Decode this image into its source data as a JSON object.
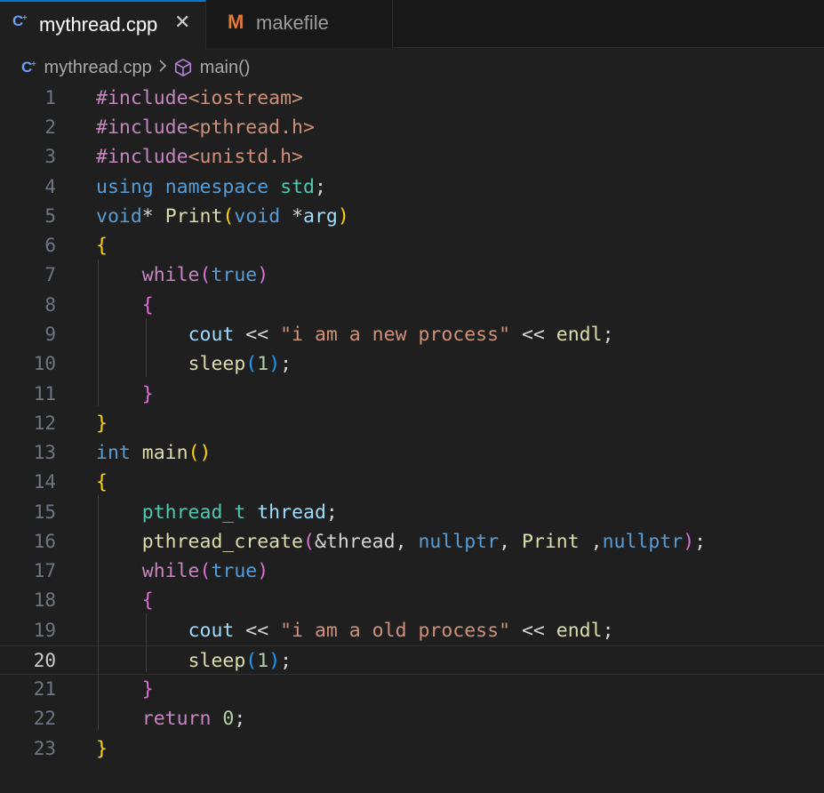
{
  "tabs": [
    {
      "label": "mythread.cpp",
      "icon": "cpp-file-icon",
      "active": true
    },
    {
      "label": "makefile",
      "icon": "makefile-icon",
      "active": false
    }
  ],
  "breadcrumb": {
    "file": "mythread.cpp",
    "symbol": "main()"
  },
  "editor": {
    "current_line": 20,
    "line_numbers": [
      "1",
      "2",
      "3",
      "4",
      "5",
      "6",
      "7",
      "8",
      "9",
      "10",
      "11",
      "12",
      "13",
      "14",
      "15",
      "16",
      "17",
      "18",
      "19",
      "20",
      "21",
      "22",
      "23"
    ],
    "tokens": {
      "l1": [
        "#include",
        "<iostream>"
      ],
      "l2": [
        "#include",
        "<pthread.h>"
      ],
      "l3": [
        "#include",
        "<unistd.h>"
      ],
      "l4": [
        "using",
        " ",
        "namespace",
        " ",
        "std",
        ";"
      ],
      "l5": [
        "void",
        "*",
        " ",
        "Print",
        "(",
        "void",
        " *",
        "arg",
        ")"
      ],
      "l6": [
        "{"
      ],
      "l7": [
        "while",
        "(",
        "true",
        ")"
      ],
      "l8": [
        "{"
      ],
      "l9": [
        "cout",
        " << ",
        "\"i am a new process\"",
        " << ",
        "endl",
        ";"
      ],
      "l10": [
        "sleep",
        "(",
        "1",
        ")",
        ";"
      ],
      "l11": [
        "}"
      ],
      "l12": [
        "}"
      ],
      "l13": [
        "int",
        " ",
        "main",
        "()"
      ],
      "l14": [
        "{"
      ],
      "l15": [
        "pthread_t",
        " ",
        "thread",
        ";"
      ],
      "l16": [
        "pthread_create",
        "(",
        "&thread",
        ", ",
        "nullptr",
        ", ",
        "Print",
        " ,",
        "nullptr",
        ")",
        ";"
      ],
      "l17": [
        "while",
        "(",
        "true",
        ")"
      ],
      "l18": [
        "{"
      ],
      "l19": [
        "cout",
        " << ",
        "\"i am a old process\"",
        " << ",
        "endl",
        ";"
      ],
      "l20": [
        "sleep",
        "(",
        "1",
        ")",
        ";"
      ],
      "l21": [
        "}"
      ],
      "l22": [
        "return",
        " ",
        "0",
        ";"
      ],
      "l23": [
        "}"
      ]
    }
  },
  "colors": {
    "background": "#1f1f1f",
    "tab_active_border": "#0078d4",
    "preprocessor": "#c586c0",
    "include_path": "#ce9178",
    "keyword": "#569cd6",
    "type": "#4ec9b0",
    "function": "#dcdcaa",
    "variable": "#9cdcfe",
    "string": "#ce9178",
    "number": "#b5cea8",
    "bracket_level1": "#ffd700",
    "bracket_level2": "#da70d6",
    "bracket_level3": "#179fff"
  }
}
